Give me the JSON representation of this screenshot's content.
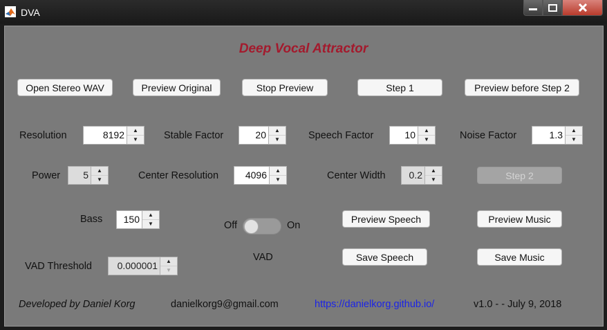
{
  "window": {
    "title": "DVA",
    "icon": "matlab-icon"
  },
  "heading": "Deep Vocal Attractor",
  "buttons": {
    "open_stereo": "Open Stereo WAV",
    "preview_original": "Preview Original",
    "stop_preview": "Stop Preview",
    "step1": "Step 1",
    "preview_before_step2": "Preview before Step 2",
    "step2": "Step 2",
    "preview_speech": "Preview Speech",
    "preview_music": "Preview Music",
    "save_speech": "Save Speech",
    "save_music": "Save Music"
  },
  "params": {
    "resolution": {
      "label": "Resolution",
      "value": "8192"
    },
    "stable_factor": {
      "label": "Stable Factor",
      "value": "20"
    },
    "speech_factor": {
      "label": "Speech Factor",
      "value": "10"
    },
    "noise_factor": {
      "label": "Noise Factor",
      "value": "1.3"
    },
    "power": {
      "label": "Power",
      "value": "5"
    },
    "center_resolution": {
      "label": "Center Resolution",
      "value": "4096"
    },
    "center_width": {
      "label": "Center Width",
      "value": "0.2"
    },
    "bass": {
      "label": "Bass",
      "value": "150"
    },
    "vad_threshold": {
      "label": "VAD Threshold",
      "value": "0.000001"
    }
  },
  "vad": {
    "off_label": "Off",
    "on_label": "On",
    "label": "VAD",
    "state": "off"
  },
  "footer": {
    "developer": "Developed by Daniel Korg",
    "email": "danielkorg9@gmail.com",
    "url": "https://danielkorg.github.io/",
    "version": "v1.0 - - July 9, 2018"
  },
  "colors": {
    "panel": "#7a7a7a",
    "heading": "#a31a2d",
    "link": "#1c24e6"
  }
}
